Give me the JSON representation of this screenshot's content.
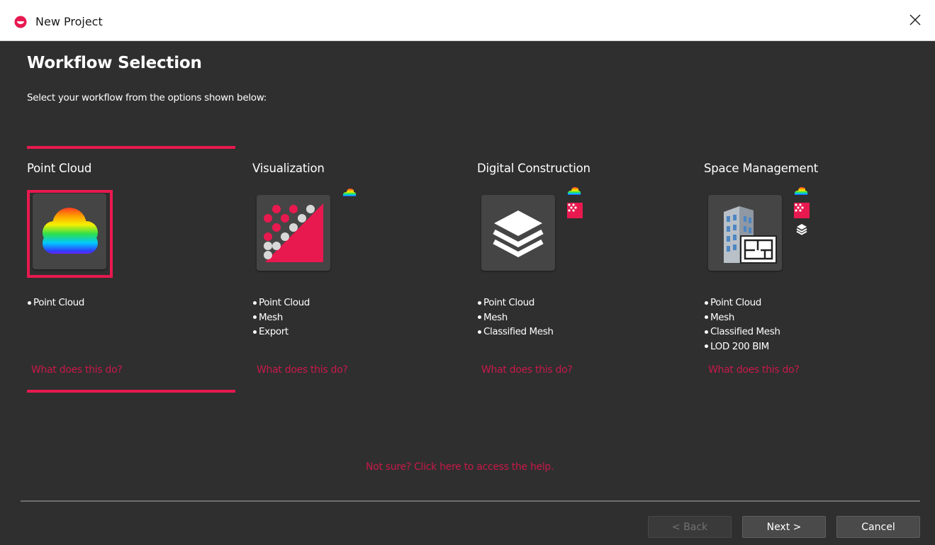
{
  "window": {
    "title": "New Project",
    "close_icon": "close-icon"
  },
  "page": {
    "heading": "Workflow Selection",
    "subheading": "Select your workflow from the options shown below:"
  },
  "options": [
    {
      "title": "Point Cloud",
      "icon": "point-cloud-icon",
      "selected": true,
      "features": [
        "Point Cloud"
      ],
      "link": "What does this do?"
    },
    {
      "title": "Visualization",
      "icon": "visualization-icon",
      "selected": false,
      "features": [
        "Point Cloud",
        "Mesh",
        "Export"
      ],
      "link": "What does this do?"
    },
    {
      "title": "Digital Construction",
      "icon": "digital-construction-icon",
      "selected": false,
      "features": [
        "Point Cloud",
        "Mesh",
        "Classified Mesh"
      ],
      "link": "What does this do?"
    },
    {
      "title": "Space Management",
      "icon": "space-management-icon",
      "selected": false,
      "features": [
        "Point Cloud",
        "Mesh",
        "Classified Mesh",
        "LOD 200 BIM"
      ],
      "link": "What does this do?"
    }
  ],
  "help_link": "Not sure? Click here to access the help.",
  "buttons": {
    "back": "< Back",
    "back_enabled": false,
    "next": "Next >",
    "cancel": "Cancel"
  },
  "colors": {
    "accent": "#e8194f",
    "link": "#c8194a",
    "background": "#2f2f2f",
    "tile": "#454545"
  }
}
